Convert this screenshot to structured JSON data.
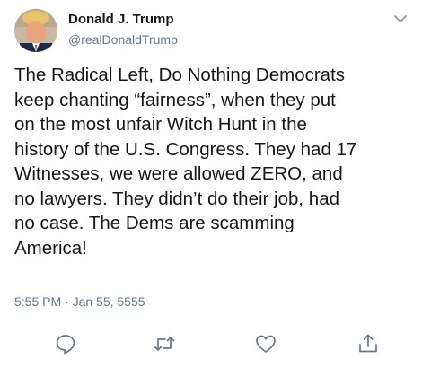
{
  "author": {
    "name": "Donald J. Trump",
    "handle": "@realDonaldTrump"
  },
  "tweet": {
    "text": "The Radical Left, Do Nothing Democrats\nkeep chanting “fairness”, when they put\non the most unfair Witch Hunt in the\nhistory of the U.S. Congress. They had 17\nWitnesses, we were allowed ZERO, and\nno lawyers. They didn’t do their job, had\nno case. The Dems are scamming\nAmerica!",
    "timestamp": "5:55 PM · Jan 55, 5555"
  },
  "actions": [
    {
      "icon": "reply-icon"
    },
    {
      "icon": "retweet-icon"
    },
    {
      "icon": "like-icon"
    },
    {
      "icon": "share-icon"
    }
  ],
  "colors": {
    "text": "#14171a",
    "secondary": "#657786",
    "divider": "#e6ecf0"
  }
}
